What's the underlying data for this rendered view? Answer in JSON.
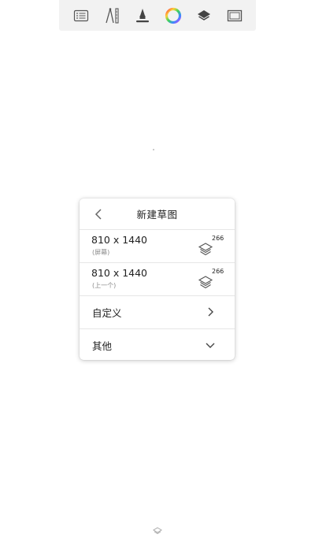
{
  "toolbar": {
    "icons": [
      "list-icon",
      "ruler-compass-icon",
      "pen-icon",
      "color-wheel-icon",
      "layers-icon",
      "canvas-frame-icon"
    ]
  },
  "dialog": {
    "title": "新建草图",
    "rows": [
      {
        "size": "810 x 1440",
        "subtitle": "(屏幕)",
        "layer_count": "266"
      },
      {
        "size": "810 x 1440",
        "subtitle": "(上一个)",
        "layer_count": "266"
      }
    ],
    "custom_label": "自定义",
    "other_label": "其他"
  },
  "colors": {
    "toolbar_bg": "#f2f2f2",
    "divider": "#e6e6e6",
    "text": "#222222"
  }
}
